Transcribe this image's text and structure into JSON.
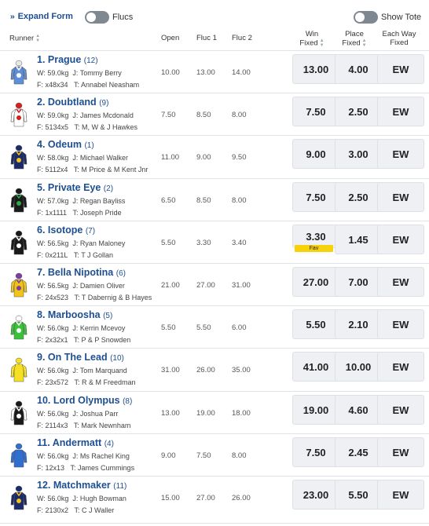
{
  "topbar": {
    "expand_label": "Expand Form",
    "flucs_label": "Flucs",
    "show_tote_label": "Show Tote"
  },
  "columns": {
    "runner": "Runner",
    "open": "Open",
    "fluc1": "Fluc 1",
    "fluc2": "Fluc 2",
    "win_line1": "Win",
    "win_line2": "Fixed",
    "place_line1": "Place",
    "place_line2": "Fixed",
    "ew_line1": "Each Way",
    "ew_line2": "Fixed"
  },
  "colors": {
    "accent": "#1d4f91",
    "fav": "#f7d20a",
    "button_bg": "#eef0f3"
  },
  "fav_label": "Fav",
  "runners": [
    {
      "name": "1. Prague",
      "barrier": "(12)",
      "weight": "W: 59.0kg",
      "jockey": "J: Tommy Berry",
      "form": "F: x48x34",
      "trainer": "T: Annabel Neasham",
      "open": "10.00",
      "fluc1": "13.00",
      "fluc2": "14.00",
      "win": "13.00",
      "place": "4.00",
      "ew": "EW",
      "silk": {
        "body": "#5d8fd6",
        "sleeve": "#5d8fd6",
        "cap": "#e8e8e8",
        "mark": "#ffffff"
      }
    },
    {
      "name": "2. Doubtland",
      "barrier": "(9)",
      "weight": "W: 59.0kg",
      "jockey": "J: James Mcdonald",
      "form": "F: 5134x5",
      "trainer": "T: M, W & J Hawkes",
      "open": "7.50",
      "fluc1": "8.50",
      "fluc2": "8.00",
      "win": "7.50",
      "place": "2.50",
      "ew": "EW",
      "silk": {
        "body": "#ffffff",
        "sleeve": "#ffffff",
        "cap": "#d42020",
        "mark": "#d42020"
      }
    },
    {
      "name": "4. Odeum",
      "barrier": "(1)",
      "weight": "W: 58.0kg",
      "jockey": "J: Michael Walker",
      "form": "F: 5112x4",
      "trainer": "T: M Price & M Kent Jnr",
      "open": "11.00",
      "fluc1": "9.00",
      "fluc2": "9.50",
      "win": "9.00",
      "place": "3.00",
      "ew": "EW",
      "silk": {
        "body": "#1b2a6b",
        "sleeve": "#1b2a6b",
        "cap": "#1b2a6b",
        "mark": "#f2c418"
      }
    },
    {
      "name": "5. Private Eye",
      "barrier": "(2)",
      "weight": "W: 57.0kg",
      "jockey": "J: Regan Bayliss",
      "form": "F: 1x1111",
      "trainer": "T: Joseph Pride",
      "open": "6.50",
      "fluc1": "8.50",
      "fluc2": "8.00",
      "win": "7.50",
      "place": "2.50",
      "ew": "EW",
      "silk": {
        "body": "#1a1a1a",
        "sleeve": "#1a1a1a",
        "cap": "#1a1a1a",
        "mark": "#2ea84a"
      }
    },
    {
      "name": "6. Isotope",
      "barrier": "(7)",
      "weight": "W: 56.5kg",
      "jockey": "J: Ryan Maloney",
      "form": "F: 0x211L",
      "trainer": "T: T J Gollan",
      "open": "5.50",
      "fluc1": "3.30",
      "fluc2": "3.40",
      "win": "3.30",
      "place": "1.45",
      "ew": "EW",
      "fav": true,
      "silk": {
        "body": "#1a1a1a",
        "sleeve": "#1a1a1a",
        "cap": "#1a1a1a",
        "mark": "#ffffff"
      }
    },
    {
      "name": "7. Bella Nipotina",
      "barrier": "(6)",
      "weight": "W: 56.5kg",
      "jockey": "J: Damien Oliver",
      "form": "F: 24x523",
      "trainer": "T: T Dabernig & B Hayes",
      "open": "21.00",
      "fluc1": "27.00",
      "fluc2": "31.00",
      "win": "27.00",
      "place": "7.00",
      "ew": "EW",
      "silk": {
        "body": "#f2c418",
        "sleeve": "#f2c418",
        "cap": "#7a3fa0",
        "mark": "#7a3fa0"
      }
    },
    {
      "name": "8. Marboosha",
      "barrier": "(5)",
      "weight": "W: 56.0kg",
      "jockey": "J: Kerrin Mcevoy",
      "form": "F: 2x32x1",
      "trainer": "T: P & P Snowden",
      "open": "5.50",
      "fluc1": "5.50",
      "fluc2": "6.00",
      "win": "5.50",
      "place": "2.10",
      "ew": "EW",
      "silk": {
        "body": "#3ac23a",
        "sleeve": "#3ac23a",
        "cap": "#ffffff",
        "mark": "#ffffff"
      }
    },
    {
      "name": "9. On The Lead",
      "barrier": "(10)",
      "weight": "W: 56.0kg",
      "jockey": "J: Tom Marquand",
      "form": "F: 23x572",
      "trainer": "T: R & M Freedman",
      "open": "31.00",
      "fluc1": "26.00",
      "fluc2": "35.00",
      "win": "41.00",
      "place": "10.00",
      "ew": "EW",
      "silk": {
        "body": "#f5e023",
        "sleeve": "#f5e023",
        "cap": "#f5e023",
        "mark": "#f5e023"
      }
    },
    {
      "name": "10. Lord Olympus",
      "barrier": "(8)",
      "weight": "W: 56.0kg",
      "jockey": "J: Joshua Parr",
      "form": "F: 2114x3",
      "trainer": "T: Mark Newnham",
      "open": "13.00",
      "fluc1": "19.00",
      "fluc2": "18.00",
      "win": "19.00",
      "place": "4.60",
      "ew": "EW",
      "silk": {
        "body": "#1a1a1a",
        "sleeve": "#ffffff",
        "cap": "#1a1a1a",
        "mark": "#ffffff"
      }
    },
    {
      "name": "11. Andermatt",
      "barrier": "(4)",
      "weight": "W: 56.0kg",
      "jockey": "J: Ms Rachel King",
      "form": "F: 12x13",
      "trainer": "T: James Cummings",
      "open": "9.00",
      "fluc1": "7.50",
      "fluc2": "8.00",
      "win": "7.50",
      "place": "2.45",
      "ew": "EW",
      "silk": {
        "body": "#2f6fd0",
        "sleeve": "#2f6fd0",
        "cap": "#2f6fd0",
        "mark": "#2f6fd0"
      }
    },
    {
      "name": "12. Matchmaker",
      "barrier": "(11)",
      "weight": "W: 56.0kg",
      "jockey": "J: Hugh Bowman",
      "form": "F: 2130x2",
      "trainer": "T: C J Waller",
      "open": "15.00",
      "fluc1": "27.00",
      "fluc2": "26.00",
      "win": "23.00",
      "place": "5.50",
      "ew": "EW",
      "silk": {
        "body": "#1b2a6b",
        "sleeve": "#1b2a6b",
        "cap": "#1b2a6b",
        "mark": "#f2c418"
      }
    }
  ]
}
